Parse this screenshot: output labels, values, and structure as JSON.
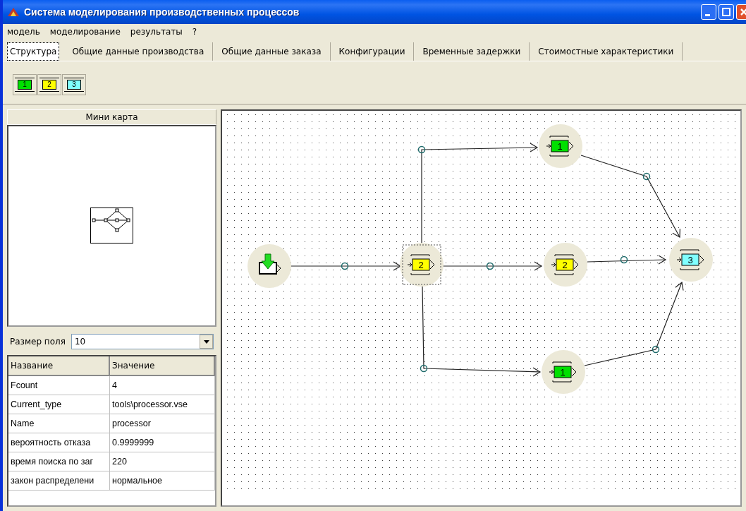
{
  "window": {
    "title": "Система моделирования производственных процессов"
  },
  "menu": [
    "модель",
    "моделирование",
    "результаты",
    "?"
  ],
  "tabs": [
    {
      "label": "Структура",
      "selected": true
    },
    {
      "label": "Общие данные производства",
      "selected": false
    },
    {
      "label": "Общие данные заказа",
      "selected": false
    },
    {
      "label": "Конфигурации",
      "selected": false
    },
    {
      "label": "Временные задержки",
      "selected": false
    },
    {
      "label": "Стоимостные характеристики",
      "selected": false
    }
  ],
  "toolbar": [
    {
      "label": "1",
      "color": "#00e000"
    },
    {
      "label": "2",
      "color": "#ffff00"
    },
    {
      "label": "3",
      "color": "#80ffff"
    }
  ],
  "minimap": {
    "title": "Мини карта"
  },
  "field_size": {
    "label": "Размер поля",
    "value": "10"
  },
  "properties": {
    "columns": [
      "Название",
      "Значение"
    ],
    "rows": [
      [
        "Fcount",
        "4"
      ],
      [
        "Current_type",
        "tools\\processor.vse"
      ],
      [
        "Name",
        "processor"
      ],
      [
        "вероятность отказа",
        "0.9999999"
      ],
      [
        "время поиска по заг",
        "220"
      ],
      [
        "закон распределени",
        "нормальное"
      ]
    ]
  },
  "diagram": {
    "nodes": [
      {
        "kind": "source",
        "selected": false
      },
      {
        "kind": "processor",
        "label": "2",
        "color": "#ffff00",
        "selected": true
      },
      {
        "kind": "processor",
        "label": "1",
        "color": "#00e000",
        "selected": false
      },
      {
        "kind": "processor",
        "label": "2",
        "color": "#ffff00",
        "selected": false
      },
      {
        "kind": "processor",
        "label": "3",
        "color": "#80ffff",
        "selected": false
      },
      {
        "kind": "processor",
        "label": "1",
        "color": "#00e000",
        "selected": false
      }
    ]
  }
}
